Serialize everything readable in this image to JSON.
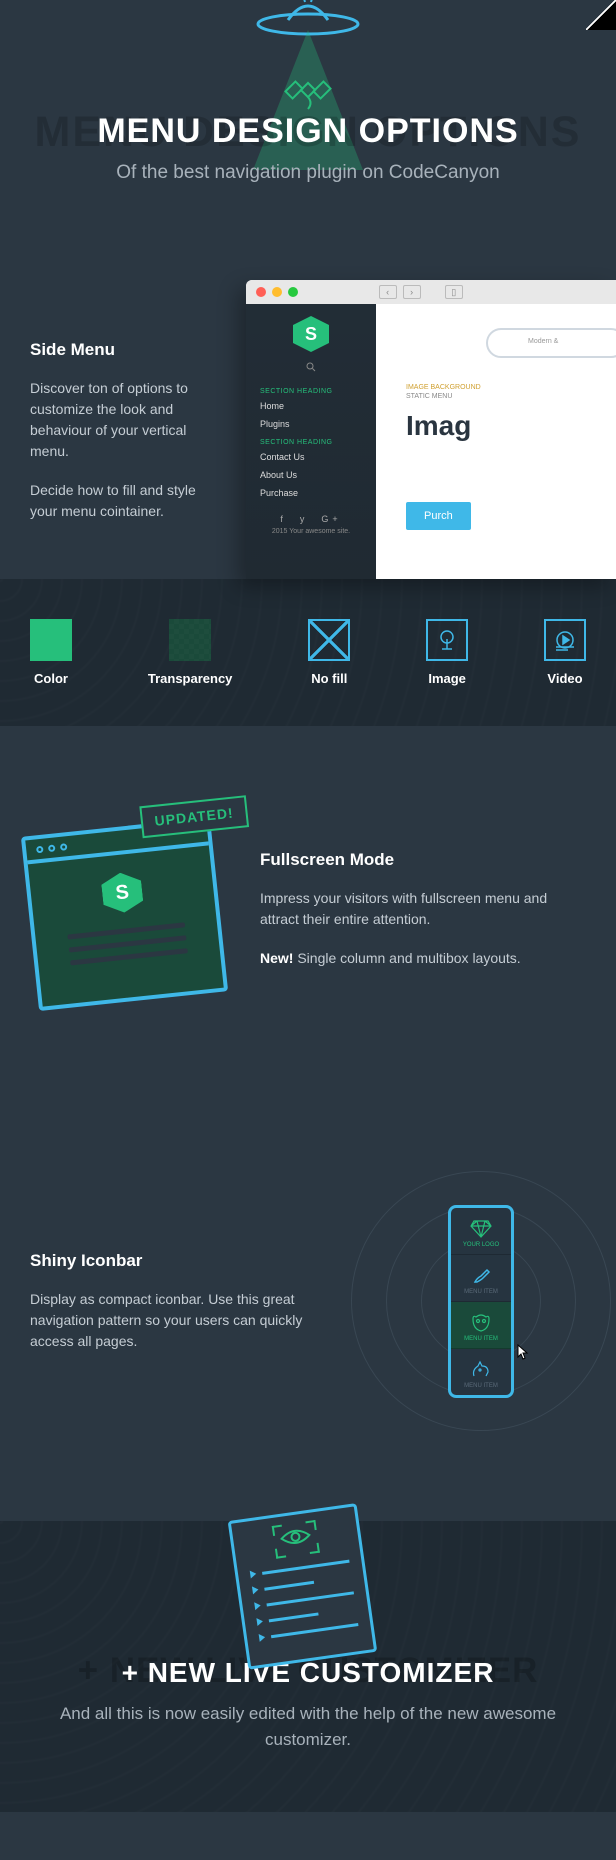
{
  "hero": {
    "shadow": "MENU DESIGN OPTIONS",
    "title": "MENU DESIGN OPTIONS",
    "subtitle": "Of the best navigation plugin on CodeCanyon"
  },
  "side": {
    "heading": "Side Menu",
    "p1": "Discover ton of options to customize the look and behaviour of your vertical menu.",
    "p2": "Decide how to fill and style your menu cointainer."
  },
  "menu": {
    "logo": "S",
    "section1": "SECTION HEADING",
    "items1": [
      "Home",
      "Plugins"
    ],
    "section2": "SECTION HEADING",
    "items2": [
      "Contact Us",
      "About Us",
      "Purchase"
    ],
    "copyright": "2015 Your awesome site."
  },
  "page": {
    "label1": "IMAGE BACKGROUND",
    "label2": "STATIC MENU",
    "heading": "Imag",
    "button": "Purch",
    "cloud": "Modern &"
  },
  "options": [
    {
      "label": "Color"
    },
    {
      "label": "Transparency"
    },
    {
      "label": "No fill"
    },
    {
      "label": "Image"
    },
    {
      "label": "Video"
    }
  ],
  "fullscreen": {
    "badge": "UPDATED!",
    "heading": "Fullscreen Mode",
    "p1": "Impress your visitors with fullscreen menu and attract their entire attention.",
    "new": "New!",
    "p2": " Single column and multibox layouts."
  },
  "iconbar": {
    "heading": "Shiny Iconbar",
    "p1": "Display as compact iconbar. Use this great navigation pattern so your users can quickly access all pages.",
    "items": [
      {
        "label": "YOUR LOGO"
      },
      {
        "label": "MENU ITEM"
      },
      {
        "label": "MENU ITEM"
      },
      {
        "label": "MENU ITEM"
      }
    ]
  },
  "customizer": {
    "shadow": "+ NEW LIVE CUSTOMIZER",
    "title": "+ NEW LIVE CUSTOMIZER",
    "subtitle": "And all this is now easily edited with the help of the new awesome customizer."
  }
}
